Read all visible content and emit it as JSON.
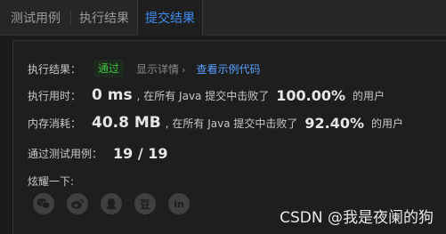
{
  "tabs": [
    {
      "label": "测试用例"
    },
    {
      "label": "执行结果"
    },
    {
      "label": "提交结果"
    }
  ],
  "result": {
    "label": "执行结果：",
    "status": "通过",
    "detail_link": "显示详情",
    "detail_chevron": "›",
    "view_code": "查看示例代码"
  },
  "runtime": {
    "label": "执行用时：",
    "value": "0 ms",
    "mid": ", 在所有 Java 提交中击败了",
    "percent": "100.00%",
    "suffix": "的用户"
  },
  "memory": {
    "label": "内存消耗：",
    "value": "40.8 MB",
    "mid": ", 在所有 Java 提交中击败了",
    "percent": "92.40%",
    "suffix": "的用户"
  },
  "testcases": {
    "label": "通过测试用例：",
    "value": "19 / 19"
  },
  "share": {
    "label": "炫耀一下:",
    "icons": [
      {
        "name": "wechat-icon"
      },
      {
        "name": "weibo-icon"
      },
      {
        "name": "qq-icon"
      },
      {
        "name": "douban-icon",
        "text": "豆"
      },
      {
        "name": "linkedin-icon",
        "text": "in"
      }
    ]
  },
  "watermark": "CSDN @我是夜阑的狗",
  "colors": {
    "accent": "#3e8cf0",
    "pass": "#40c040",
    "link": "#5aa0ff"
  }
}
